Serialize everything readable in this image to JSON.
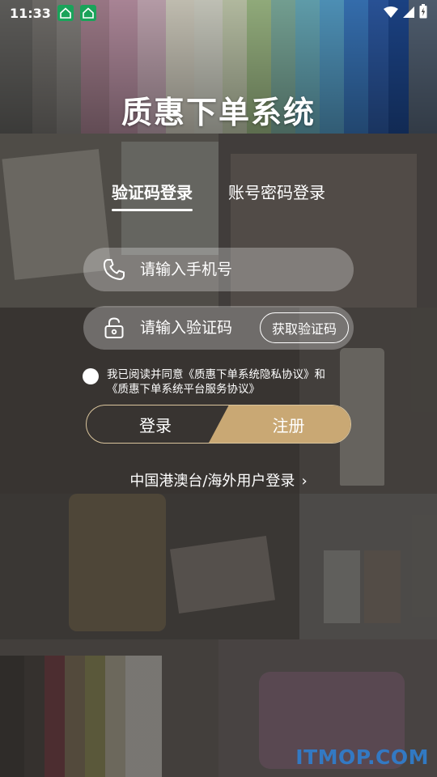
{
  "status_bar": {
    "time": "11:33",
    "left_icons": [
      "app-notification-icon",
      "app-notification-icon"
    ],
    "right_icons": [
      "wifi-icon",
      "cell-signal-icon",
      "battery-charging-icon"
    ]
  },
  "app": {
    "title": "质惠下单系统"
  },
  "tabs": {
    "sms_login": "验证码登录",
    "password_login": "账号密码登录"
  },
  "form": {
    "phone_placeholder": "请输入手机号",
    "code_placeholder": "请输入验证码",
    "get_code_label": "获取验证码"
  },
  "agreement": {
    "line1": "我已阅读并同意《质惠下单系统隐私协议》和",
    "line2": "《质惠下单系统平台服务协议》",
    "checked": false
  },
  "actions": {
    "login_label": "登录",
    "register_label": "注册"
  },
  "overseas": {
    "label": "中国港澳台/海外用户登录",
    "chevron": "›"
  },
  "watermark": {
    "text": "ITMOP.COM"
  },
  "colors": {
    "accent_gold": "#c9a874",
    "badge_green": "#1aa35a",
    "watermark_blue": "#2f7fd0"
  }
}
